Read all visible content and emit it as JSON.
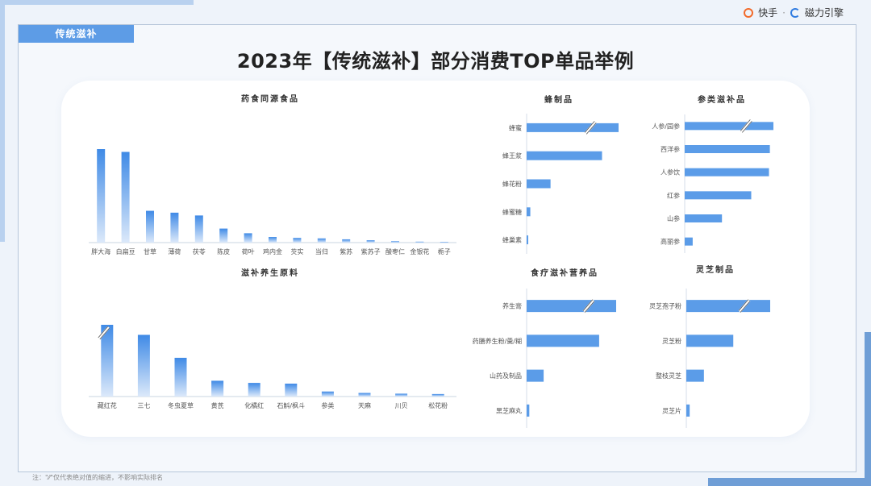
{
  "brand": {
    "left": "快手",
    "separator": "·",
    "right": "磁力引擎"
  },
  "section_tag": "传统滋补",
  "title": "2023年【传统滋补】部分消费TOP单品举例",
  "note": "注：\"⁄⁄\"仅代表绝对值的缩进，不影响实际排名",
  "colors": {
    "bar_top": "#3f8ae6",
    "bar_bottom": "#dce9fa",
    "hbar": "#5b9ce8",
    "tag": "#5d9ce6",
    "accent_bar": "#6f9ed6"
  },
  "icons": {
    "brand_left": "kuaishou-logo-icon",
    "brand_right": "cili-engine-logo-icon",
    "break": "axis-break-icon"
  },
  "chart_data": [
    {
      "type": "bar",
      "title": "药食同源食品",
      "categories": [
        "胖大海",
        "白扁豆",
        "甘草",
        "薄荷",
        "茯苓",
        "陈皮",
        "荷叶",
        "鸡内金",
        "芡实",
        "当归",
        "紫苏",
        "紫苏子",
        "酸枣仁",
        "金银花",
        "栀子"
      ],
      "values": [
        100,
        97,
        34,
        32,
        29,
        15,
        10,
        6,
        5,
        4.5,
        3.5,
        2.5,
        1.5,
        1,
        0.8
      ],
      "ylim": [
        0,
        100
      ],
      "grid": false
    },
    {
      "type": "bar",
      "title": "滋补养生原料",
      "categories": [
        "藏红花",
        "三七",
        "冬虫夏草",
        "黄芪",
        "化橘红",
        "石斛/枫斗",
        "参类",
        "天麻",
        "川贝",
        "松花粉"
      ],
      "values": [
        100,
        86,
        54,
        22,
        19,
        18,
        7,
        5,
        4,
        3.5
      ],
      "ylim": [
        0,
        100
      ],
      "axis_break_on": [
        "藏红花"
      ],
      "grid": false
    },
    {
      "type": "bar",
      "orientation": "horizontal",
      "title": "蜂制品",
      "categories": [
        "蜂蜜",
        "蜂王浆",
        "蜂花粉",
        "蜂蜜糖",
        "蜂巢素"
      ],
      "values": [
        100,
        82,
        26,
        4,
        1
      ],
      "axis_break_on": [
        "蜂蜜"
      ]
    },
    {
      "type": "bar",
      "orientation": "horizontal",
      "title": "参类滋补品",
      "categories": [
        "人参/园参",
        "西洋参",
        "人参饮",
        "红参",
        "山参",
        "高丽参"
      ],
      "values": [
        100,
        96,
        95,
        75,
        42,
        9
      ],
      "axis_break_on": [
        "人参/园参"
      ]
    },
    {
      "type": "bar",
      "orientation": "horizontal",
      "title": "食疗滋补营养品",
      "categories": [
        "养生膏",
        "药膳养生粉/羹/糊",
        "山药及制品",
        "黑芝麻丸"
      ],
      "values": [
        100,
        81,
        19,
        3
      ],
      "axis_break_on": [
        "养生膏"
      ]
    },
    {
      "type": "bar",
      "orientation": "horizontal",
      "title": "灵芝制品",
      "categories": [
        "灵芝孢子粉",
        "灵芝粉",
        "整枝灵芝",
        "灵芝片"
      ],
      "values": [
        100,
        56,
        21,
        4
      ],
      "axis_break_on": [
        "灵芝孢子粉"
      ]
    }
  ]
}
